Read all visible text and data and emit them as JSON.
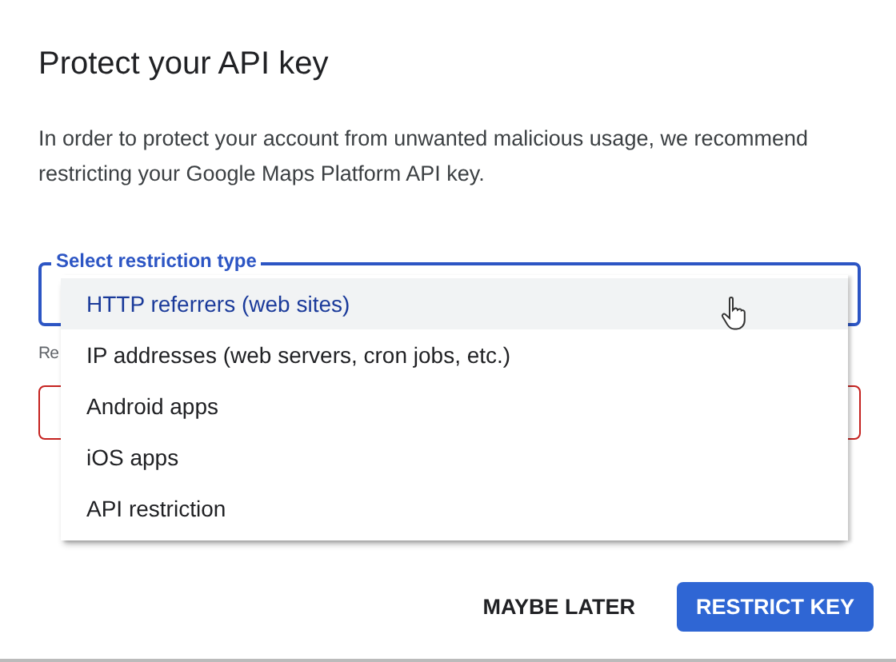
{
  "dialog": {
    "title": "Protect your API key",
    "message": "In order to protect your account from unwanted malicious usage, we recommend restricting your Google Maps Platform API key."
  },
  "restriction_select": {
    "label": "Select restriction type",
    "focused": true
  },
  "hint": "Re",
  "second_field": {
    "error": true
  },
  "menu": {
    "options": [
      {
        "label": "HTTP referrers (web sites)",
        "selected": true
      },
      {
        "label": "IP addresses (web servers, cron jobs, etc.)",
        "selected": false
      },
      {
        "label": "Android apps",
        "selected": false
      },
      {
        "label": "iOS apps",
        "selected": false
      },
      {
        "label": "API restriction",
        "selected": false
      }
    ]
  },
  "buttons": [
    {
      "label": "MAYBE LATER",
      "kind": "text"
    },
    {
      "label": "RESTRICT KEY",
      "kind": "primary"
    }
  ]
}
